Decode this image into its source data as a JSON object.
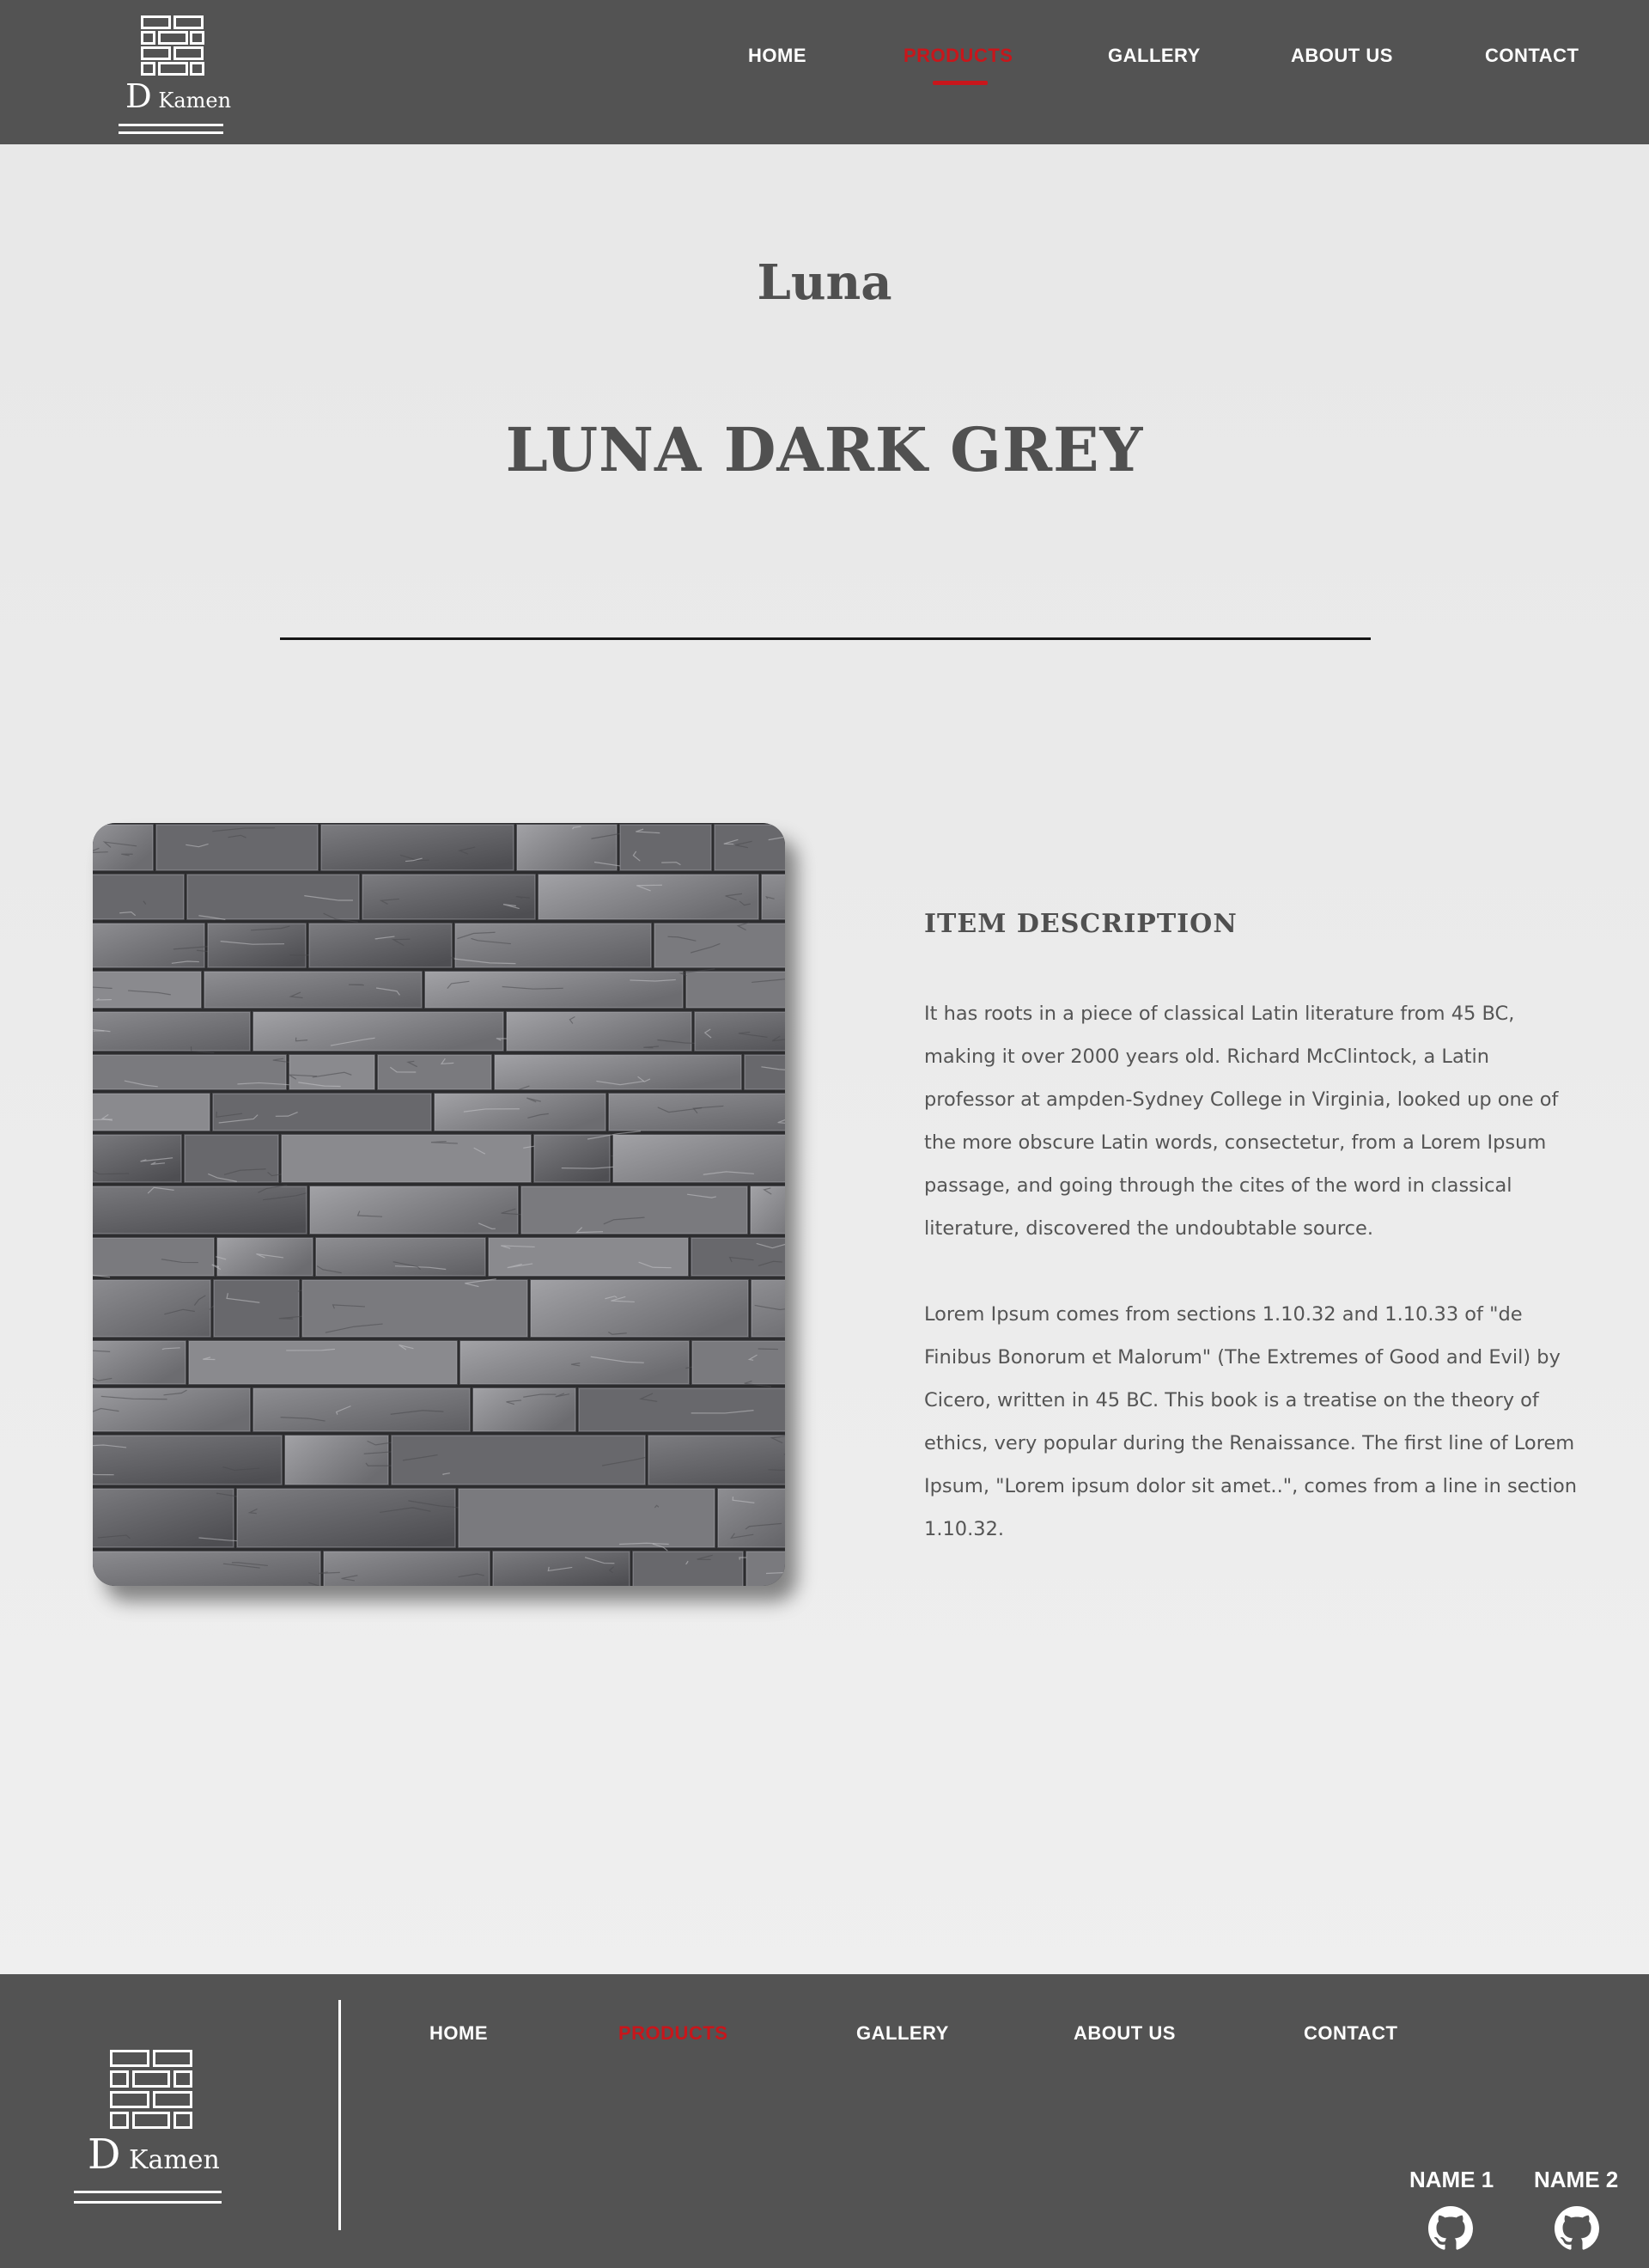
{
  "brand": {
    "logo_letter": "D",
    "logo_word": "Kamen"
  },
  "nav": {
    "items": [
      {
        "label": "HOME",
        "active": false
      },
      {
        "label": "PRODUCTS",
        "active": true
      },
      {
        "label": "GALLERY",
        "active": false
      },
      {
        "label": "ABOUT US",
        "active": false
      },
      {
        "label": "CONTACT",
        "active": false
      }
    ]
  },
  "product": {
    "collection": "Luna",
    "name": "LUNA DARK GREY",
    "description_heading": "ITEM DESCRIPTION",
    "paragraphs": [
      "It has roots in a piece of classical Latin literature from 45 BC, making it over 2000 years old. Richard McClintock, a Latin professor at  ampden-Sydney College in Virginia, looked up one of the more obscure Latin words, consectetur, from a Lorem Ipsum passage, and going  through the cites of the word in classical literature, discovered the undoubtable source.",
      "Lorem Ipsum comes from sections 1.10.32 and 1.10.33 of \"de Finibus Bonorum et Malorum\" (The Extremes of Good and Evil) by Cicero, written in 45 BC. This book is a treatise on the theory of ethics, very popular during the Renaissance. The first line of  Lorem Ipsum, \"Lorem ipsum dolor sit amet..\", comes from a line in section 1.10.32."
    ]
  },
  "footer": {
    "credits": [
      {
        "name": "NAME 1",
        "icon": "github-icon"
      },
      {
        "name": "NAME 2",
        "icon": "github-icon"
      }
    ]
  },
  "colors": {
    "header_bg": "#535353",
    "accent": "#c8161b",
    "page_bg": "#ececec",
    "text": "#505050"
  }
}
